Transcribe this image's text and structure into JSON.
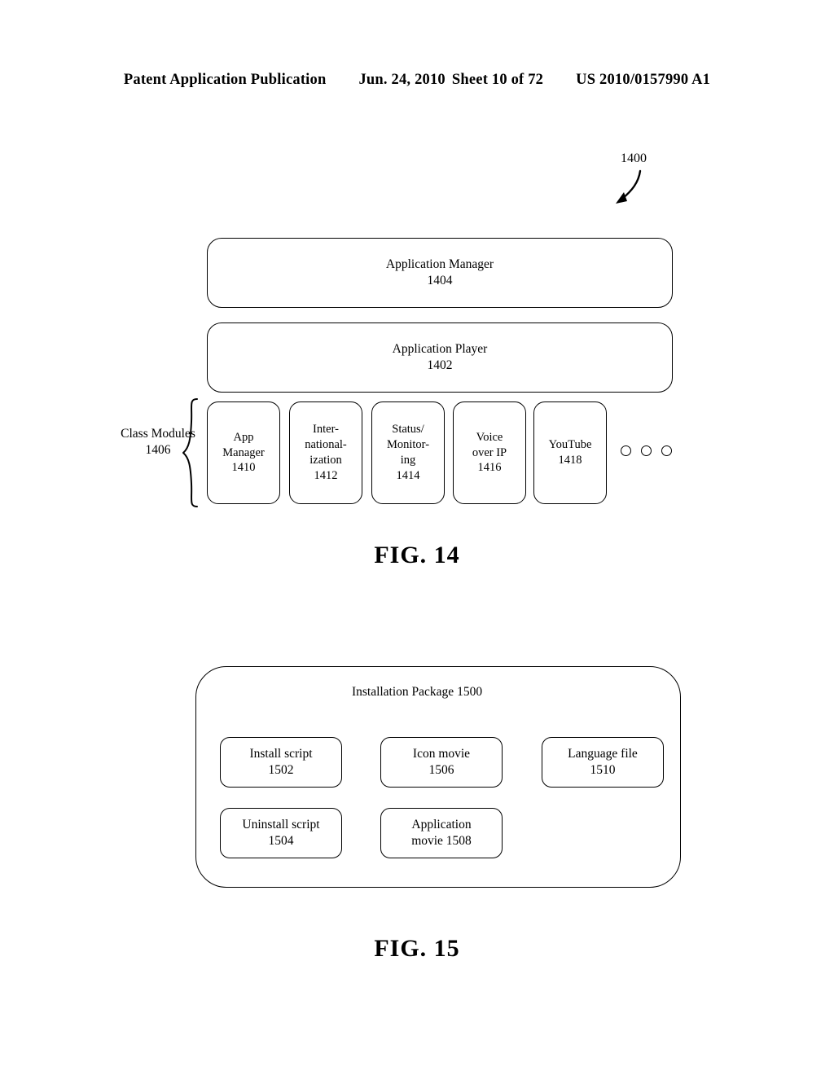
{
  "header": {
    "publication": "Patent Application Publication",
    "date": "Jun. 24, 2010",
    "sheet": "Sheet 10 of 72",
    "patent_number": "US 2010/0157990 A1"
  },
  "figures": [
    {
      "caption": "FIG. 14",
      "ref_numeral": "1400",
      "stacked_boxes": [
        {
          "title": "Application Manager",
          "ref": "1404"
        },
        {
          "title": "Application Player",
          "ref": "1402"
        }
      ],
      "group_label": {
        "line1": "Class",
        "line2": "Modules",
        "ref": "1406"
      },
      "modules": [
        {
          "lines": [
            "App",
            "Manager"
          ],
          "ref": "1410"
        },
        {
          "lines": [
            "Inter-",
            "national-",
            "ization"
          ],
          "ref": "1412"
        },
        {
          "lines": [
            "Status/",
            "Monitor-",
            "ing"
          ],
          "ref": "1414"
        },
        {
          "lines": [
            "Voice",
            "over IP"
          ],
          "ref": "1416"
        },
        {
          "lines": [
            "YouTube"
          ],
          "ref": "1418"
        }
      ],
      "continuation_dots": 3
    },
    {
      "caption": "FIG. 15",
      "container": {
        "title": "Installation Package",
        "ref": "1500"
      },
      "items": [
        {
          "lines": [
            "Install script",
            "1502"
          ]
        },
        {
          "lines": [
            "Icon movie",
            "1506"
          ]
        },
        {
          "lines": [
            "Language file",
            "1510"
          ]
        },
        {
          "lines": [
            "Uninstall script",
            "1504"
          ]
        },
        {
          "lines": [
            "Application",
            "movie 1508"
          ]
        }
      ]
    }
  ],
  "colors": {
    "ink": "#000000",
    "paper": "#ffffff"
  }
}
